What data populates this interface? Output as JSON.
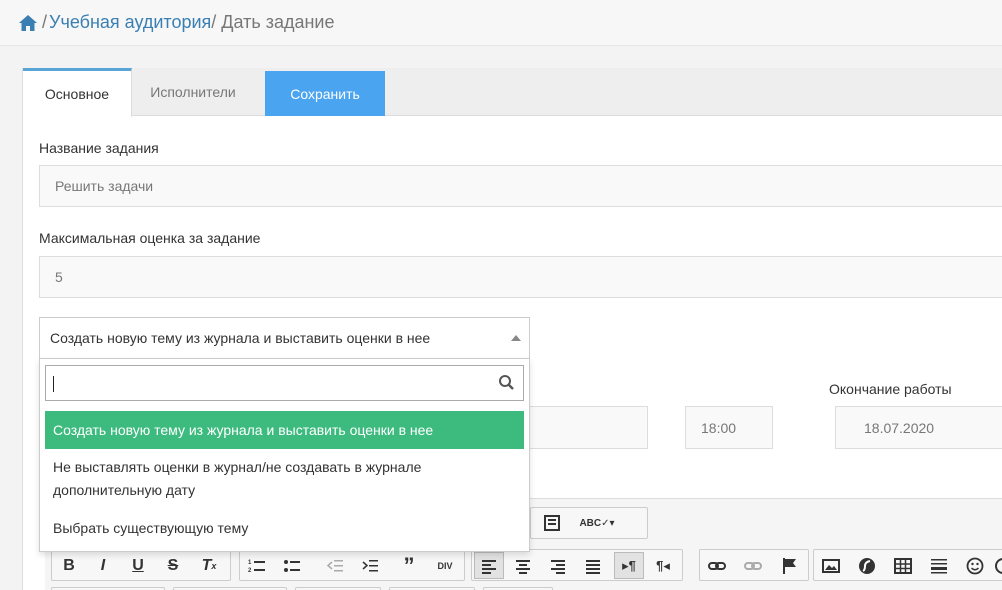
{
  "breadcrumb": {
    "items": [
      "/",
      "Учебная аудитория",
      "/ Дать задание"
    ]
  },
  "tabs": {
    "main": "Основное",
    "executors": "Исполнители",
    "save": "Сохранить"
  },
  "form": {
    "task_name_label": "Название задания",
    "task_name_value": "Решить задачи",
    "max_grade_label": "Максимальная оценка за задание",
    "max_grade_value": "5",
    "mode_select_value": "Создать новую тему из журнала и выставить оценки в нее",
    "end_label": "Окончание работы",
    "time_value": "18:00",
    "date_value": "18.07.2020"
  },
  "dropdown": {
    "search_value": "",
    "options": [
      "Создать новую тему из журнала и выставить оценки в нее",
      "Не выставлять оценки в журнал/не создавать в журнале дополнительную дату",
      "Выбрать существующую тему"
    ]
  },
  "colors": {
    "link": "#3a7fb3",
    "save_tab": "#4aa4f0",
    "active_option": "#3dbb7f"
  }
}
